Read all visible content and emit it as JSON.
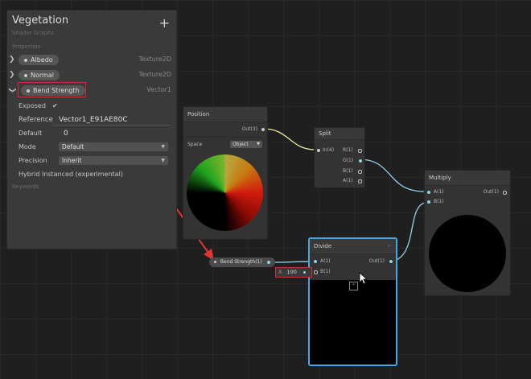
{
  "blackboard": {
    "title": "Vegetation",
    "subtitle": "Shader Graphs",
    "add_icon": "+",
    "section_properties": "Properties",
    "properties": [
      {
        "name": "Albedo",
        "type": "Texture2D"
      },
      {
        "name": "Normal",
        "type": "Texture2D"
      },
      {
        "name": "Bend Strength",
        "type": "Vector1"
      }
    ],
    "details": {
      "exposed_label": "Exposed",
      "exposed_value": "✔",
      "reference_label": "Reference",
      "reference_value": "Vector1_E91AE80C",
      "default_label": "Default",
      "default_value": "0",
      "mode_label": "Mode",
      "mode_value": "Default",
      "precision_label": "Precision",
      "precision_value": "Inherit",
      "hybrid_label": "Hybrid Instanced (experimental)"
    },
    "section_keywords": "Keywords"
  },
  "nodes": {
    "position": {
      "title": "Position",
      "out_port": "Out(3)",
      "space_label": "Space",
      "space_value": "Object"
    },
    "split": {
      "title": "Split",
      "in_port": "In(4)",
      "outs": [
        "R(1)",
        "G(1)",
        "B(1)",
        "A(1)"
      ]
    },
    "multiply": {
      "title": "Multiply",
      "ins": [
        "A(1)",
        "B(1)"
      ],
      "out_port": "Out(1)"
    },
    "divide": {
      "title": "Divide",
      "ins": [
        "A(1)",
        "B(1)"
      ],
      "out_port": "Out(1)"
    },
    "bend_strength": {
      "label": "Bend Strength(1)"
    },
    "x_field": {
      "axis": "X",
      "value": "100"
    }
  },
  "colors": {
    "highlight": "#d03030",
    "selection": "#4aa6e0",
    "edge_float": "#8fd3e6",
    "edge_vector": "#e8e8a0"
  },
  "icons": [
    "plus-icon",
    "chevron-right-icon",
    "chevron-down-icon",
    "checkmark-icon",
    "dropdown-arrow-icon",
    "collapse-icon",
    "mouse-cursor-icon",
    "red-arrow-annotation"
  ]
}
